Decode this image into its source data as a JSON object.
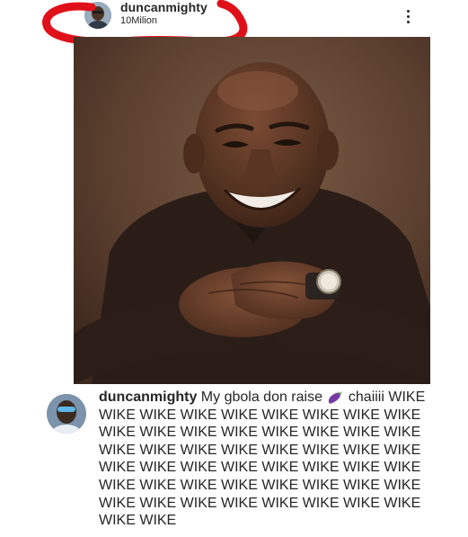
{
  "post": {
    "author": {
      "username": "duncanmighty",
      "subtitle": "10Milion",
      "avatar_icon": "profile-avatar"
    },
    "more_icon": "more-vertical-icon",
    "annotation_color": "#e0101a"
  },
  "caption": {
    "username": "duncanmighty",
    "text_before_emoji": "My gbola don raise",
    "emoji_icon": "eggplant-emoji",
    "text_after_emoji": "chaiiii WIKE WIKE WIKE WIKE WIKE WIKE WIKE WIKE WIKE WIKE WIKE WIKE WIKE WIKE WIKE WIKE WIKE WIKE WIKE WIKE WIKE WIKE WIKE WIKE WIKE WIKE WIKE WIKE WIKE WIKE WIKE WIKE WIKE WIKE WIKE WIKE WIKE WIKE WIKE WIKE WIKE WIKE WIKE WIKE WIKE WIKE WIKE WIKE WIKE WIKE WIKE"
  }
}
